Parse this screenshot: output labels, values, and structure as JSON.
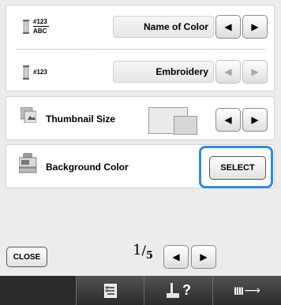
{
  "settings": {
    "row1": {
      "icon_top": "#123",
      "icon_bottom": "ABC",
      "value": "Name of Color"
    },
    "row2": {
      "icon_text": "#123",
      "value": "Embroidery"
    },
    "row3": {
      "label": "Thumbnail Size"
    },
    "row4": {
      "label": "Background Color",
      "select_label": "SELECT"
    }
  },
  "footer": {
    "close_label": "CLOSE",
    "page_current": "1",
    "page_total": "5"
  },
  "bottom_bar": {
    "help_label": "?"
  },
  "colors": {
    "select_outline": "#2f8be6",
    "bottom_bar": "#2a2a2a"
  }
}
